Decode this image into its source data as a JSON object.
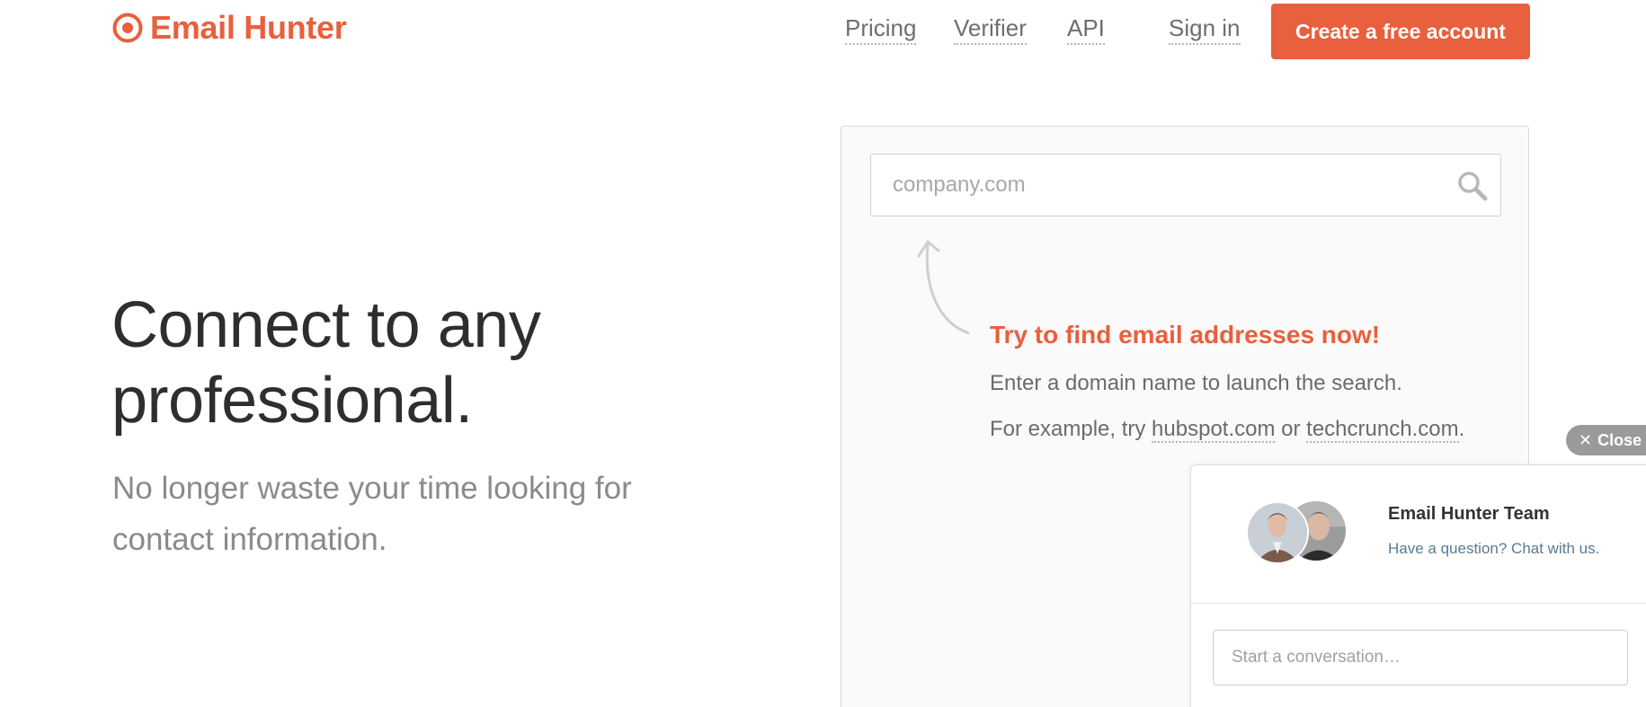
{
  "brand": {
    "name": "Email Hunter",
    "color": "#e8603d",
    "icon": "target-icon"
  },
  "nav": {
    "pricing": "Pricing",
    "verifier": "Verifier",
    "api": "API",
    "sign_in": "Sign in",
    "cta": "Create a free account"
  },
  "hero": {
    "title_line1": "Connect to any",
    "title_line2": "professional.",
    "subtitle_line1": "No longer waste your time looking for",
    "subtitle_line2": "contact information."
  },
  "search": {
    "placeholder": "company.com",
    "icon": "search-icon",
    "arrow_icon": "curved-arrow-icon",
    "prompt_title": "Try to find email addresses now!",
    "prompt_line": "Enter a domain name to launch the search.",
    "example_prefix": "For example, try ",
    "example_1": "hubspot.com",
    "example_or": " or ",
    "example_2": "techcrunch.com",
    "example_suffix": "."
  },
  "chat": {
    "close_label": "Close",
    "close_icon": "close-icon",
    "team_name": "Email Hunter Team",
    "tagline": "Have a question? Chat with us.",
    "input_placeholder": "Start a conversation…"
  }
}
